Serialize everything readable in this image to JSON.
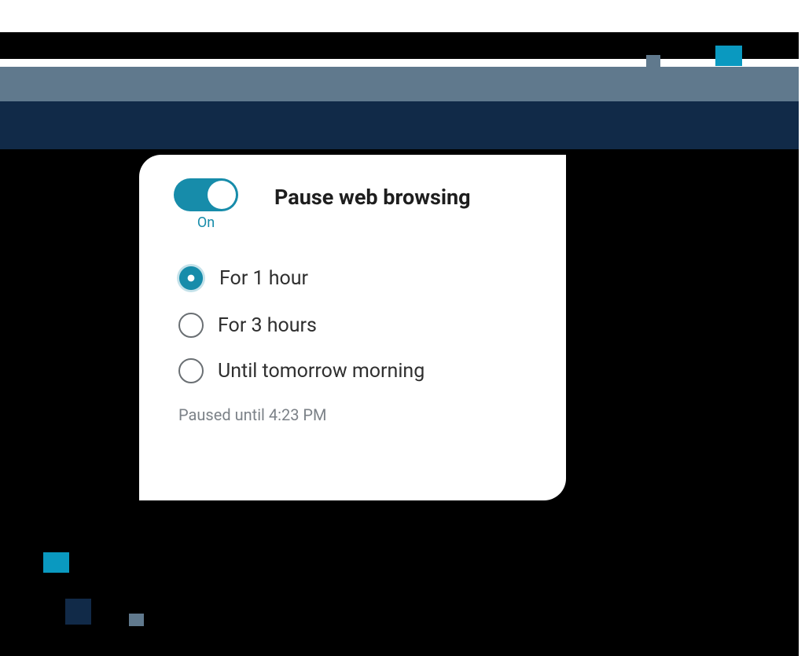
{
  "colors": {
    "accent": "#178caa",
    "navy": "#112a48",
    "gray": "#60798d"
  },
  "card": {
    "title": "Pause web browsing",
    "toggle_state_label": "On",
    "status_text": "Paused until 4:23 PM",
    "options": [
      {
        "label": "For 1 hour",
        "selected": true
      },
      {
        "label": "For 3 hours",
        "selected": false
      },
      {
        "label": "Until tomorrow morning",
        "selected": false
      }
    ]
  }
}
